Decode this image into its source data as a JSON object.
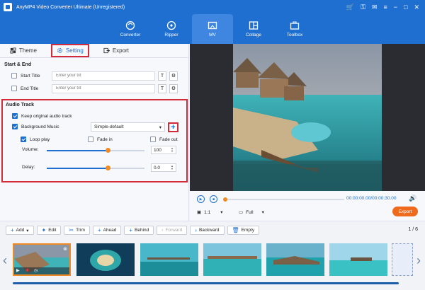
{
  "app": {
    "title": "AnyMP4 Video Converter Ultimate (Unregistered)"
  },
  "nav": [
    {
      "label": "Converter",
      "icon": "converter-icon"
    },
    {
      "label": "Ripper",
      "icon": "ripper-icon"
    },
    {
      "label": "MV",
      "icon": "mv-icon",
      "active": true
    },
    {
      "label": "Collage",
      "icon": "collage-icon"
    },
    {
      "label": "Toolbox",
      "icon": "toolbox-icon"
    }
  ],
  "tabs": {
    "theme": "Theme",
    "setting": "Setting",
    "export": "Export"
  },
  "start_end": {
    "title": "Start & End",
    "start_title": {
      "label": "Start Title",
      "placeholder": "Enter your txt",
      "checked": false
    },
    "end_title": {
      "label": "End Title",
      "placeholder": "Enter your txt",
      "checked": false
    }
  },
  "audio": {
    "title": "Audio Track",
    "keep_original": {
      "label": "Keep original audio track",
      "checked": true
    },
    "background_music": {
      "label": "Background Music",
      "checked": true,
      "selected": "Simple-default"
    },
    "add_label": "+",
    "loop_play": {
      "label": "Loop play",
      "checked": true
    },
    "fade_in": {
      "label": "Fade in",
      "checked": false
    },
    "fade_out": {
      "label": "Fade out",
      "checked": false
    },
    "volume": {
      "label": "Volume:",
      "value": "100",
      "level": 0.62
    },
    "delay": {
      "label": "Delay:",
      "value": "0.0",
      "level": 0.62
    }
  },
  "player": {
    "time": "00:00:00.00/00:00:30.00",
    "ratio": "1:1",
    "mode": "Full",
    "export_label": "Export",
    "progress": 0.0
  },
  "toolbar": {
    "add": "Add",
    "edit": "Edit",
    "trim": "Trim",
    "ahead": "Ahead",
    "behind": "Behind",
    "forward": "Forward",
    "backward": "Backward",
    "empty": "Empty",
    "page": "1 / 6"
  },
  "colors": {
    "brand": "#1f6fd1",
    "accent": "#f06a1e",
    "highlight": "#d32b3a"
  }
}
